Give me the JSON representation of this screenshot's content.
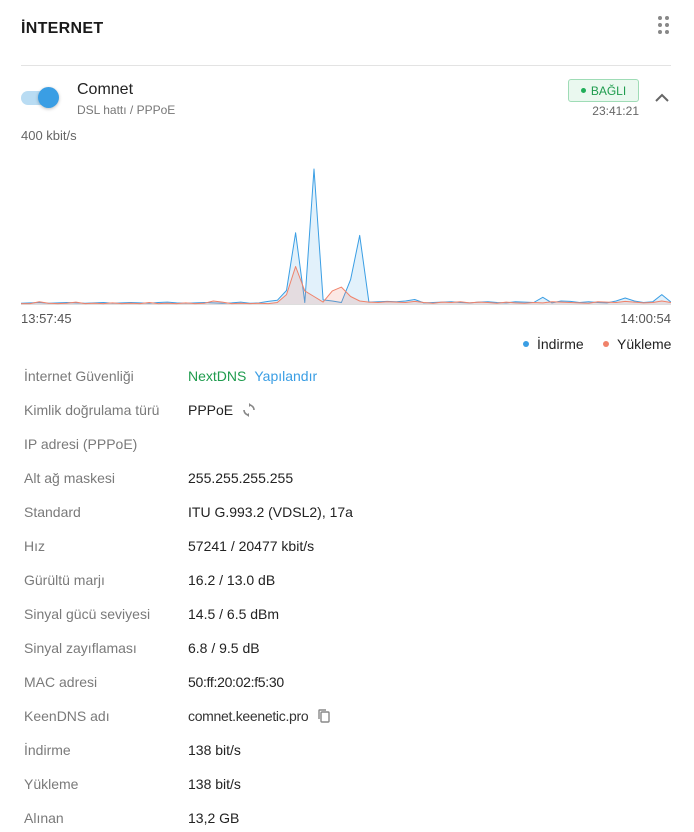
{
  "header": {
    "title": "İNTERNET",
    "drag_icon": "drag-dots-icon"
  },
  "connection": {
    "name": "Comnet",
    "subtitle": "DSL hattı / PPPoE",
    "enabled": true,
    "status": "BAĞLI",
    "time": "23:41:21",
    "status_color": "#1f9c4e",
    "collapse_icon": "chevron-up-icon"
  },
  "chart_data": {
    "type": "area",
    "y_label": "400 kbit/s",
    "ylim": [
      0,
      400
    ],
    "x_start": "13:57:45",
    "x_end": "14:00:54",
    "legend": [
      "İndirme",
      "Yükleme"
    ],
    "legend_placement": "bottom-right",
    "grid": false,
    "series": [
      {
        "name": "İndirme",
        "color": "#3a9ee4",
        "values": [
          2,
          3,
          4,
          2,
          3,
          4,
          3,
          2,
          3,
          4,
          2,
          3,
          4,
          3,
          2,
          4,
          5,
          3,
          2,
          3,
          4,
          3,
          2,
          3,
          5,
          2,
          3,
          7,
          10,
          36,
          190,
          4,
          360,
          11,
          8,
          4,
          65,
          183,
          5,
          6,
          7,
          6,
          8,
          12,
          3,
          4,
          5,
          6,
          4,
          3,
          5,
          6,
          4,
          3,
          6,
          5,
          4,
          18,
          3,
          8,
          7,
          4,
          6,
          4,
          3,
          8,
          16,
          8,
          4,
          6,
          25,
          5
        ]
      },
      {
        "name": "Yükleme",
        "color": "#f0826a",
        "values": [
          1,
          1,
          6,
          2,
          1,
          2,
          5,
          1,
          2,
          1,
          3,
          1,
          2,
          1,
          4,
          1,
          2,
          1,
          3,
          1,
          2,
          8,
          5,
          1,
          2,
          1,
          2,
          1,
          4,
          25,
          100,
          35,
          20,
          5,
          35,
          45,
          20,
          8,
          5,
          4,
          6,
          5,
          4,
          7,
          4,
          2,
          5,
          4,
          6,
          3,
          5,
          4,
          2,
          5,
          3,
          2,
          4,
          3,
          6,
          5,
          4,
          3,
          2,
          6,
          5,
          4,
          7,
          5,
          3,
          4,
          8,
          4
        ]
      }
    ]
  },
  "details": {
    "rows": [
      {
        "label": "İnternet Güvenliği",
        "value": "NextDNS",
        "link": "Yapılandır"
      },
      {
        "label": "Kimlik doğrulama türü",
        "value": "PPPoE",
        "icon": "refresh-icon"
      },
      {
        "label": "IP adresi (PPPoE)",
        "value": ""
      },
      {
        "label": "Alt ağ maskesi",
        "value": "255.255.255.255"
      },
      {
        "label": "Standard",
        "value": "ITU G.993.2 (VDSL2), 17a"
      },
      {
        "label": "Hız",
        "value": "57241 / 20477 kbit/s"
      },
      {
        "label": "Gürültü marjı",
        "value": "16.2 / 13.0 dB"
      },
      {
        "label": "Sinyal gücü seviyesi",
        "value": "14.5 / 6.5 dBm"
      },
      {
        "label": "Sinyal zayıflaması",
        "value": "6.8 / 9.5 dB"
      },
      {
        "label": "MAC adresi",
        "value": "50:ff:20:02:f5:30"
      },
      {
        "label": "KeenDNS adı",
        "value": "comnet.keenetic.pro",
        "icon": "copy-icon"
      },
      {
        "label": "İndirme",
        "value": "138 bit/s"
      },
      {
        "label": "Yükleme",
        "value": "138 bit/s"
      },
      {
        "label": "Alınan",
        "value": "13,2 GB"
      }
    ]
  }
}
